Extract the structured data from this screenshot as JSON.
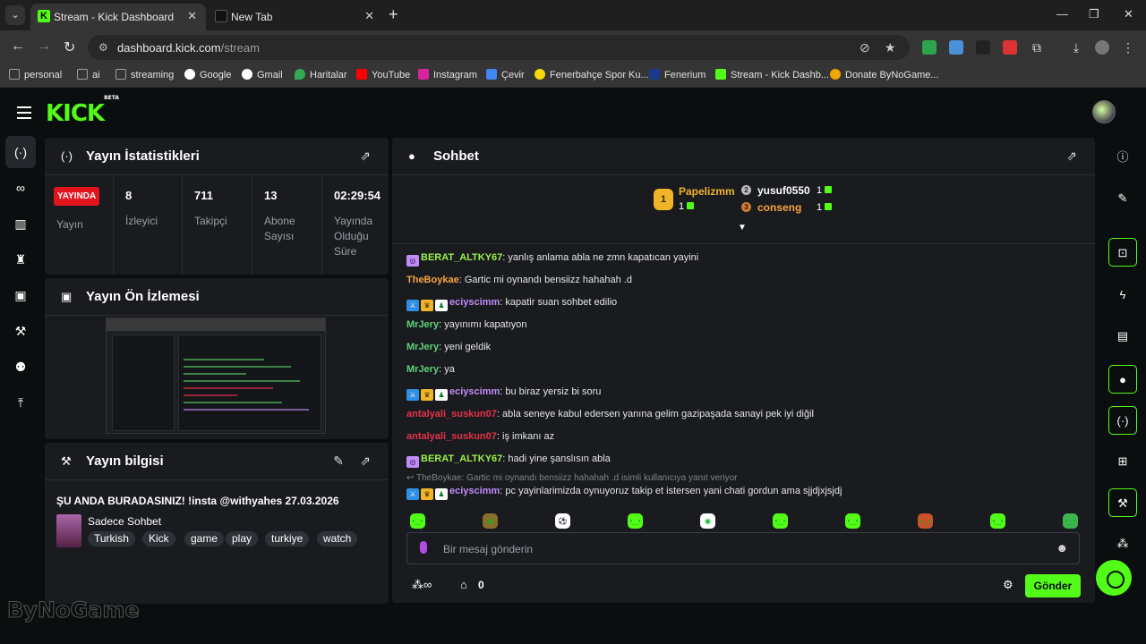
{
  "browser": {
    "tabs": [
      {
        "title": "Stream - Kick Dashboard"
      },
      {
        "title": "New Tab"
      }
    ],
    "url_host": "dashboard.kick.com",
    "url_path": "/stream",
    "bookmarks": [
      {
        "label": "personal",
        "color": "#9aa0a6"
      },
      {
        "label": "ai",
        "color": "#9aa0a6"
      },
      {
        "label": "streaming",
        "color": "#9aa0a6"
      },
      {
        "label": "Google",
        "color": "#ffffff"
      },
      {
        "label": "Gmail",
        "color": "#ffffff"
      },
      {
        "label": "Haritalar",
        "color": "#34a853"
      },
      {
        "label": "YouTube",
        "color": "#ff0000"
      },
      {
        "label": "Instagram",
        "color": "#d6249f"
      },
      {
        "label": "Çevir",
        "color": "#4285f4"
      },
      {
        "label": "Fenerbahçe Spor Ku...",
        "color": "#f5d90a"
      },
      {
        "label": "Fenerium",
        "color": "#1b3a8a"
      },
      {
        "label": "Stream - Kick Dashb...",
        "color": "#53fc18"
      },
      {
        "label": "Donate ByNoGame...",
        "color": "#f0a500"
      }
    ]
  },
  "app": {
    "logo": "KICK",
    "logo_badge": "BETA",
    "accent": "#53fc18"
  },
  "stats_panel": {
    "title": "Yayın İstatistikleri",
    "live_badge": "YAYINDA",
    "items": [
      {
        "value": "",
        "label": "Yayın"
      },
      {
        "value": "8",
        "label": "İzleyici"
      },
      {
        "value": "711",
        "label": "Takipçi"
      },
      {
        "value": "13",
        "label": "Abone Sayısı"
      },
      {
        "value": "02:29:54",
        "label": "Yayında Olduğu Süre"
      }
    ]
  },
  "preview_panel": {
    "title": "Yayın Ön İzlemesi"
  },
  "info_panel": {
    "title": "Yayın bilgisi",
    "stream_title": "ŞU ANDA BURADASINIZ! !insta @withyahes 27.03.2026",
    "category": "Sadece Sohbet",
    "tags": [
      "Turkish",
      "Kick",
      "game",
      "play",
      "turkiye",
      "watch"
    ]
  },
  "chat_panel": {
    "title": "Sohbet",
    "podium": [
      {
        "rank": "1",
        "name": "Papelizmm",
        "count": "1"
      },
      {
        "rank": "2",
        "name": "yusuf0550",
        "count": "1"
      },
      {
        "rank": "3",
        "name": "conseng",
        "count": "1"
      }
    ],
    "messages": [
      {
        "user": "BERAT_ALTKY67",
        "color": "#9ef04b",
        "text": "yanlış anlama abla ne zmn kapatıcan yayini"
      },
      {
        "user": "TheBoykae",
        "color": "#f7a440",
        "text": "Gartic mi oynandı bensiizz hahahah .d"
      },
      {
        "user": "eciyscimm",
        "color": "#c08cf8",
        "text": "kapatir suan sohbet edilio"
      },
      {
        "user": "MrJery",
        "color": "#5ed37a",
        "text": "yayınımı kapatıyon"
      },
      {
        "user": "MrJery",
        "color": "#5ed37a",
        "text": "yeni geldik"
      },
      {
        "user": "MrJery",
        "color": "#5ed37a",
        "text": "ya"
      },
      {
        "user": "eciyscimm",
        "color": "#c08cf8",
        "text": "bu biraz yersiz bi soru"
      },
      {
        "user": "antalyali_suskun07",
        "color": "#e6324b",
        "text": "abla seneye kabul edersen yanına gelim gazipaşada sanayi pek iyi diğil"
      },
      {
        "user": "antalyali_suskun07",
        "color": "#e6324b",
        "text": "iş imkanı az"
      },
      {
        "user": "BERAT_ALTKY67",
        "color": "#9ef04b",
        "text": "hadi yine şanslısın abla"
      },
      {
        "user": "eciyscimm",
        "color": "#c08cf8",
        "text": "pc yayinlarimizda oynuyoruz takip et istersen yani chati gordun ama sjjdjxjsjdj"
      }
    ],
    "reply_ref": "TheBoykae: Gartic mi oynandı bensiizz hahahah .d isimli kullanıcıya yanıt veriyor",
    "input_placeholder": "Bir mesaj gönderin",
    "points_value": "0",
    "send_label": "Gönder"
  },
  "watermark": "ByNoGame"
}
